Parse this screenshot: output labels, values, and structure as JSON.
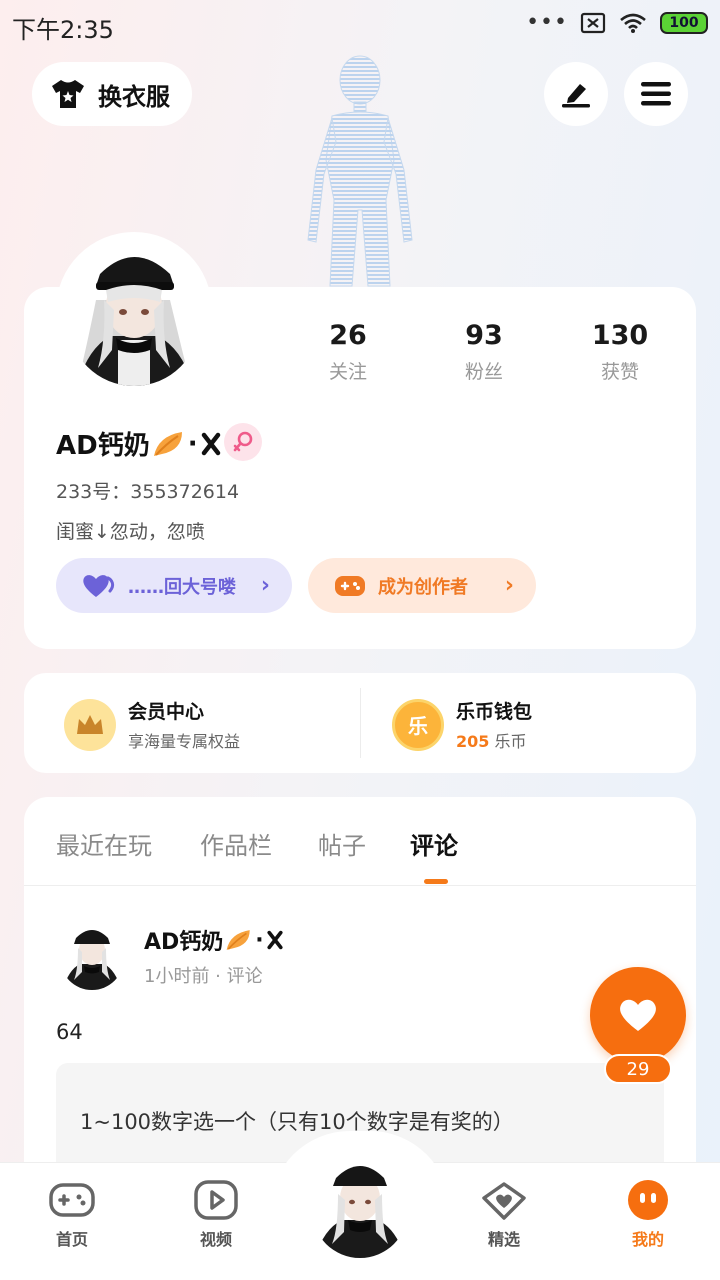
{
  "status_bar": {
    "time": "下午2:35",
    "battery": "100"
  },
  "top_bar": {
    "change_clothes_label": "换衣服"
  },
  "profile": {
    "stats": [
      {
        "value": "26",
        "label": "关注"
      },
      {
        "value": "93",
        "label": "粉丝"
      },
      {
        "value": "130",
        "label": "获赞"
      }
    ],
    "username": "AD钙奶",
    "username_suffix": "·",
    "uid": "233号：355372614",
    "bio": "闺蜜↓忽动，忽喷",
    "friend_link_label": "……回大号喽",
    "creator_button_label": "成为创作者"
  },
  "member_center": {
    "title": "会员中心",
    "subtitle": "享海量专属权益"
  },
  "wallet": {
    "title": "乐币钱包",
    "coins": "205",
    "unit": " 乐币",
    "coin_glyph": "乐"
  },
  "tabs": [
    {
      "label": "最近在玩"
    },
    {
      "label": "作品栏"
    },
    {
      "label": "帖子"
    },
    {
      "label": "评论"
    }
  ],
  "post": {
    "author": "AD钙奶",
    "author_suffix": "·",
    "meta": "1小时前 · 评论",
    "text": "64",
    "quote": "1~100数字选一个（只有10个数字是有奖的）"
  },
  "like_count": "29",
  "bottom_nav": [
    {
      "label": "首页"
    },
    {
      "label": "视频"
    },
    {
      "label": "精选"
    },
    {
      "label": "我的"
    }
  ],
  "colors": {
    "accent": "#f57a1a",
    "purple": "#6c62d8",
    "like": "#f66e0f"
  }
}
